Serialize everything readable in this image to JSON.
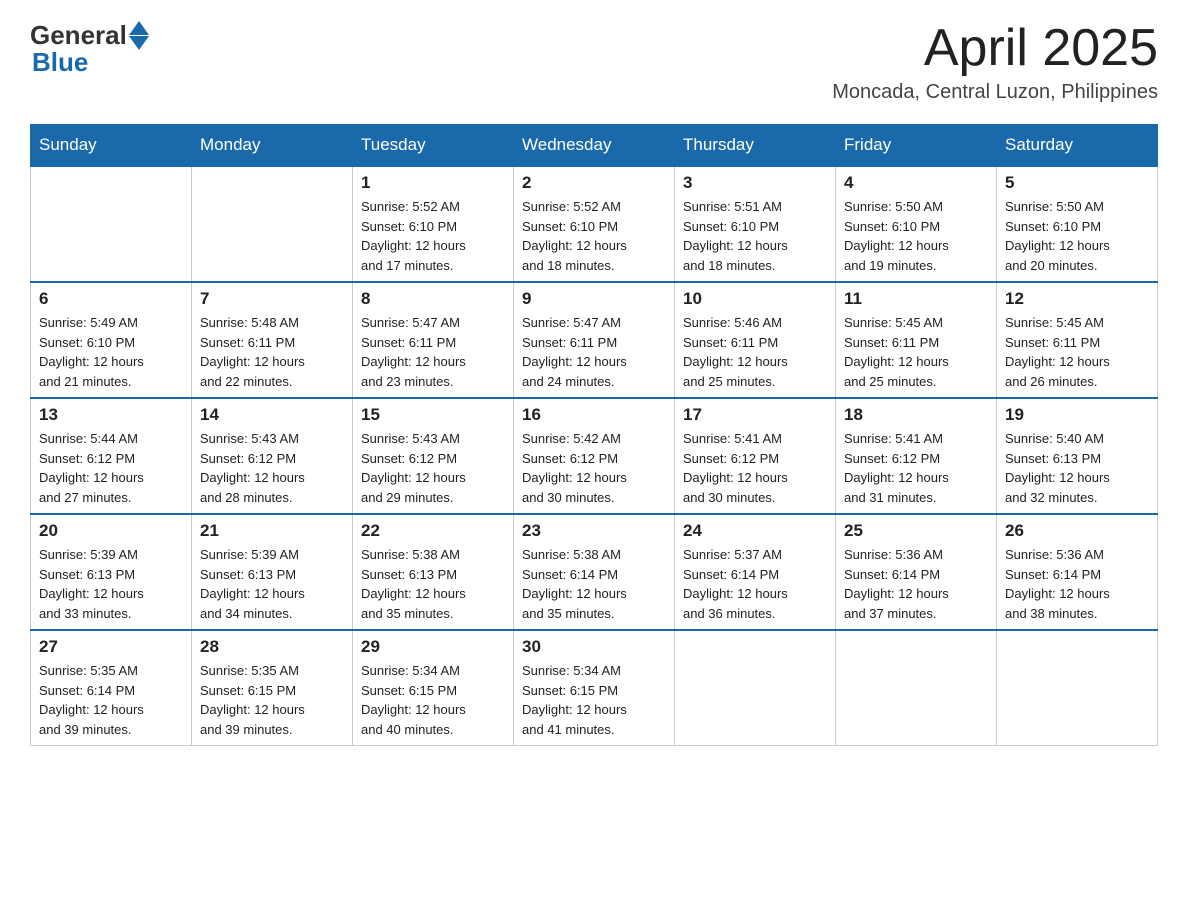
{
  "header": {
    "logo_general": "General",
    "logo_blue": "Blue",
    "month_year": "April 2025",
    "location": "Moncada, Central Luzon, Philippines"
  },
  "weekdays": [
    "Sunday",
    "Monday",
    "Tuesday",
    "Wednesday",
    "Thursday",
    "Friday",
    "Saturday"
  ],
  "weeks": [
    [
      {
        "day": "",
        "info": ""
      },
      {
        "day": "",
        "info": ""
      },
      {
        "day": "1",
        "info": "Sunrise: 5:52 AM\nSunset: 6:10 PM\nDaylight: 12 hours\nand 17 minutes."
      },
      {
        "day": "2",
        "info": "Sunrise: 5:52 AM\nSunset: 6:10 PM\nDaylight: 12 hours\nand 18 minutes."
      },
      {
        "day": "3",
        "info": "Sunrise: 5:51 AM\nSunset: 6:10 PM\nDaylight: 12 hours\nand 18 minutes."
      },
      {
        "day": "4",
        "info": "Sunrise: 5:50 AM\nSunset: 6:10 PM\nDaylight: 12 hours\nand 19 minutes."
      },
      {
        "day": "5",
        "info": "Sunrise: 5:50 AM\nSunset: 6:10 PM\nDaylight: 12 hours\nand 20 minutes."
      }
    ],
    [
      {
        "day": "6",
        "info": "Sunrise: 5:49 AM\nSunset: 6:10 PM\nDaylight: 12 hours\nand 21 minutes."
      },
      {
        "day": "7",
        "info": "Sunrise: 5:48 AM\nSunset: 6:11 PM\nDaylight: 12 hours\nand 22 minutes."
      },
      {
        "day": "8",
        "info": "Sunrise: 5:47 AM\nSunset: 6:11 PM\nDaylight: 12 hours\nand 23 minutes."
      },
      {
        "day": "9",
        "info": "Sunrise: 5:47 AM\nSunset: 6:11 PM\nDaylight: 12 hours\nand 24 minutes."
      },
      {
        "day": "10",
        "info": "Sunrise: 5:46 AM\nSunset: 6:11 PM\nDaylight: 12 hours\nand 25 minutes."
      },
      {
        "day": "11",
        "info": "Sunrise: 5:45 AM\nSunset: 6:11 PM\nDaylight: 12 hours\nand 25 minutes."
      },
      {
        "day": "12",
        "info": "Sunrise: 5:45 AM\nSunset: 6:11 PM\nDaylight: 12 hours\nand 26 minutes."
      }
    ],
    [
      {
        "day": "13",
        "info": "Sunrise: 5:44 AM\nSunset: 6:12 PM\nDaylight: 12 hours\nand 27 minutes."
      },
      {
        "day": "14",
        "info": "Sunrise: 5:43 AM\nSunset: 6:12 PM\nDaylight: 12 hours\nand 28 minutes."
      },
      {
        "day": "15",
        "info": "Sunrise: 5:43 AM\nSunset: 6:12 PM\nDaylight: 12 hours\nand 29 minutes."
      },
      {
        "day": "16",
        "info": "Sunrise: 5:42 AM\nSunset: 6:12 PM\nDaylight: 12 hours\nand 30 minutes."
      },
      {
        "day": "17",
        "info": "Sunrise: 5:41 AM\nSunset: 6:12 PM\nDaylight: 12 hours\nand 30 minutes."
      },
      {
        "day": "18",
        "info": "Sunrise: 5:41 AM\nSunset: 6:12 PM\nDaylight: 12 hours\nand 31 minutes."
      },
      {
        "day": "19",
        "info": "Sunrise: 5:40 AM\nSunset: 6:13 PM\nDaylight: 12 hours\nand 32 minutes."
      }
    ],
    [
      {
        "day": "20",
        "info": "Sunrise: 5:39 AM\nSunset: 6:13 PM\nDaylight: 12 hours\nand 33 minutes."
      },
      {
        "day": "21",
        "info": "Sunrise: 5:39 AM\nSunset: 6:13 PM\nDaylight: 12 hours\nand 34 minutes."
      },
      {
        "day": "22",
        "info": "Sunrise: 5:38 AM\nSunset: 6:13 PM\nDaylight: 12 hours\nand 35 minutes."
      },
      {
        "day": "23",
        "info": "Sunrise: 5:38 AM\nSunset: 6:14 PM\nDaylight: 12 hours\nand 35 minutes."
      },
      {
        "day": "24",
        "info": "Sunrise: 5:37 AM\nSunset: 6:14 PM\nDaylight: 12 hours\nand 36 minutes."
      },
      {
        "day": "25",
        "info": "Sunrise: 5:36 AM\nSunset: 6:14 PM\nDaylight: 12 hours\nand 37 minutes."
      },
      {
        "day": "26",
        "info": "Sunrise: 5:36 AM\nSunset: 6:14 PM\nDaylight: 12 hours\nand 38 minutes."
      }
    ],
    [
      {
        "day": "27",
        "info": "Sunrise: 5:35 AM\nSunset: 6:14 PM\nDaylight: 12 hours\nand 39 minutes."
      },
      {
        "day": "28",
        "info": "Sunrise: 5:35 AM\nSunset: 6:15 PM\nDaylight: 12 hours\nand 39 minutes."
      },
      {
        "day": "29",
        "info": "Sunrise: 5:34 AM\nSunset: 6:15 PM\nDaylight: 12 hours\nand 40 minutes."
      },
      {
        "day": "30",
        "info": "Sunrise: 5:34 AM\nSunset: 6:15 PM\nDaylight: 12 hours\nand 41 minutes."
      },
      {
        "day": "",
        "info": ""
      },
      {
        "day": "",
        "info": ""
      },
      {
        "day": "",
        "info": ""
      }
    ]
  ]
}
